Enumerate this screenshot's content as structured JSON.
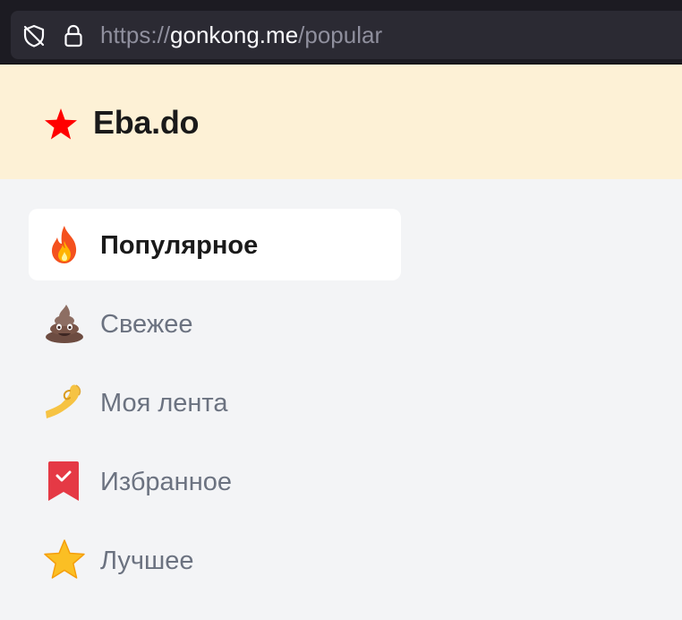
{
  "browser": {
    "url_scheme": "https://",
    "url_host": "gonkong.me",
    "url_path": "/popular"
  },
  "site": {
    "name": "Eba.do",
    "logo_color": "#ff0000"
  },
  "nav": {
    "items": [
      {
        "label": "Популярное",
        "icon": "fire-icon",
        "active": true
      },
      {
        "label": "Свежее",
        "icon": "poop-icon",
        "active": false
      },
      {
        "label": "Моя лента",
        "icon": "pinching-hand-icon",
        "active": false
      },
      {
        "label": "Избранное",
        "icon": "bookmark-icon",
        "active": false
      },
      {
        "label": "Лучшее",
        "icon": "star-icon",
        "active": false
      }
    ]
  }
}
